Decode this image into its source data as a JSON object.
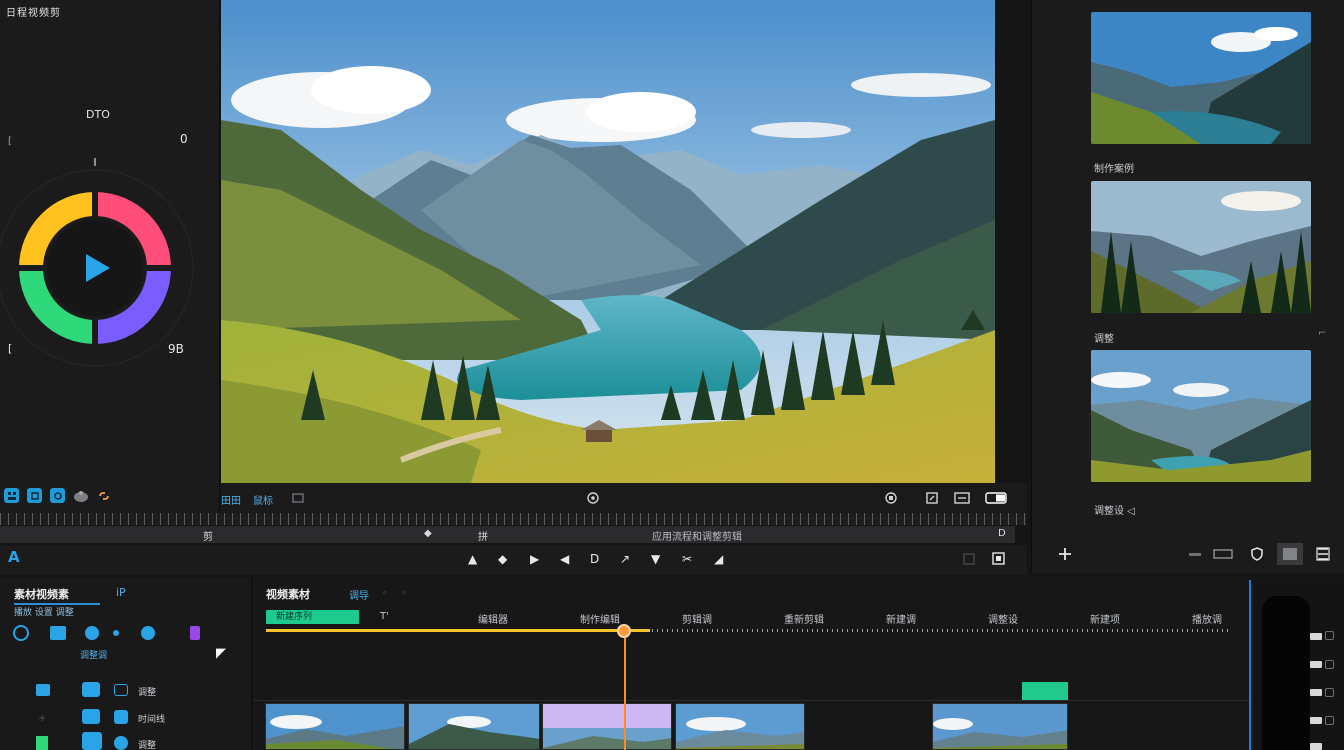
{
  "left_panel": {
    "title": "日程视频剪",
    "wheel_label": "DTO",
    "wheel_right_value": "0",
    "wheel_left_mark": "[",
    "wheel_bottom_left": "[",
    "wheel_bottom_right": "9B"
  },
  "viewer_bar": {
    "left_label_1": "田田",
    "left_label_2": "鼠标"
  },
  "right_panel": {
    "thumb_labels": [
      "制作案例",
      "调整",
      "调整设 ◁"
    ]
  },
  "scrub": {
    "label_1": "剪",
    "label_2": "拼",
    "label_3": "应用流程和调整剪辑",
    "label_4": "D"
  },
  "tool_row": {
    "glyphs": [
      "▲",
      "◆",
      "▶",
      "◀",
      "D",
      "↗",
      "▼",
      "✂",
      "◢"
    ]
  },
  "bottom_left": {
    "title": "素材视频素",
    "tab": "iP",
    "sub": "播放 设置 调整",
    "rows": [
      {
        "label": "调整"
      },
      {
        "label": "时间线"
      },
      {
        "label": "调整"
      }
    ],
    "mid_label": "调整调"
  },
  "timeline": {
    "title": "视频素材",
    "tab": "调导",
    "green_tag": "新建序列",
    "tick_labels": [
      "T'",
      "编辑器",
      "制作编辑",
      "剪辑调",
      "重新剪辑",
      "新建调",
      "调整设",
      "新建项",
      "播放调"
    ]
  },
  "colors": {
    "accent_blue": "#1f9bd8",
    "playhead": "#ff8a2a",
    "progress": "#f3c52a",
    "green": "#1ecb8e"
  }
}
